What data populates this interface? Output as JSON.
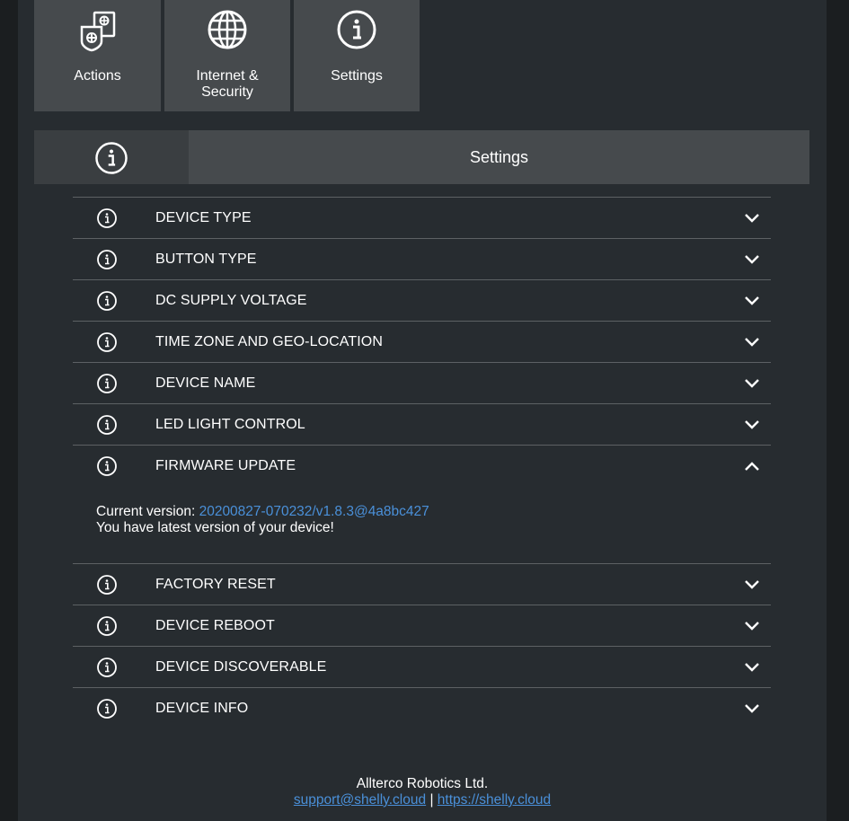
{
  "tiles": {
    "actions": {
      "label": "Actions",
      "icon": "actions-icon"
    },
    "internet": {
      "label_line1": "Internet &",
      "label_line2": "Security",
      "icon": "globe-icon"
    },
    "settings": {
      "label": "Settings",
      "icon": "info-icon"
    }
  },
  "section": {
    "title": "Settings",
    "icon": "info-icon"
  },
  "rows": [
    {
      "label": "DEVICE TYPE",
      "expanded": false
    },
    {
      "label": "BUTTON TYPE",
      "expanded": false
    },
    {
      "label": "DC SUPPLY VOLTAGE",
      "expanded": false
    },
    {
      "label": "TIME ZONE AND GEO-LOCATION",
      "expanded": false
    },
    {
      "label": "DEVICE NAME",
      "expanded": false
    },
    {
      "label": "LED LIGHT CONTROL",
      "expanded": false
    },
    {
      "label": "FIRMWARE UPDATE",
      "expanded": true
    },
    {
      "label": "FACTORY RESET",
      "expanded": false
    },
    {
      "label": "DEVICE REBOOT",
      "expanded": false
    },
    {
      "label": "DEVICE DISCOVERABLE",
      "expanded": false
    },
    {
      "label": "DEVICE INFO",
      "expanded": false
    }
  ],
  "firmware": {
    "current_label": "Current version:",
    "version": "20200827-070232/v1.8.3@4a8bc427",
    "status": "You have latest version of your device!"
  },
  "footer": {
    "company": "Allterco Robotics Ltd.",
    "email": "support@shelly.cloud",
    "separator": "|",
    "website": "https://shelly.cloud"
  },
  "colors": {
    "background": "#272c30",
    "tile": "#464a4d",
    "link": "#4a90d9",
    "divider": "#5d6164"
  }
}
